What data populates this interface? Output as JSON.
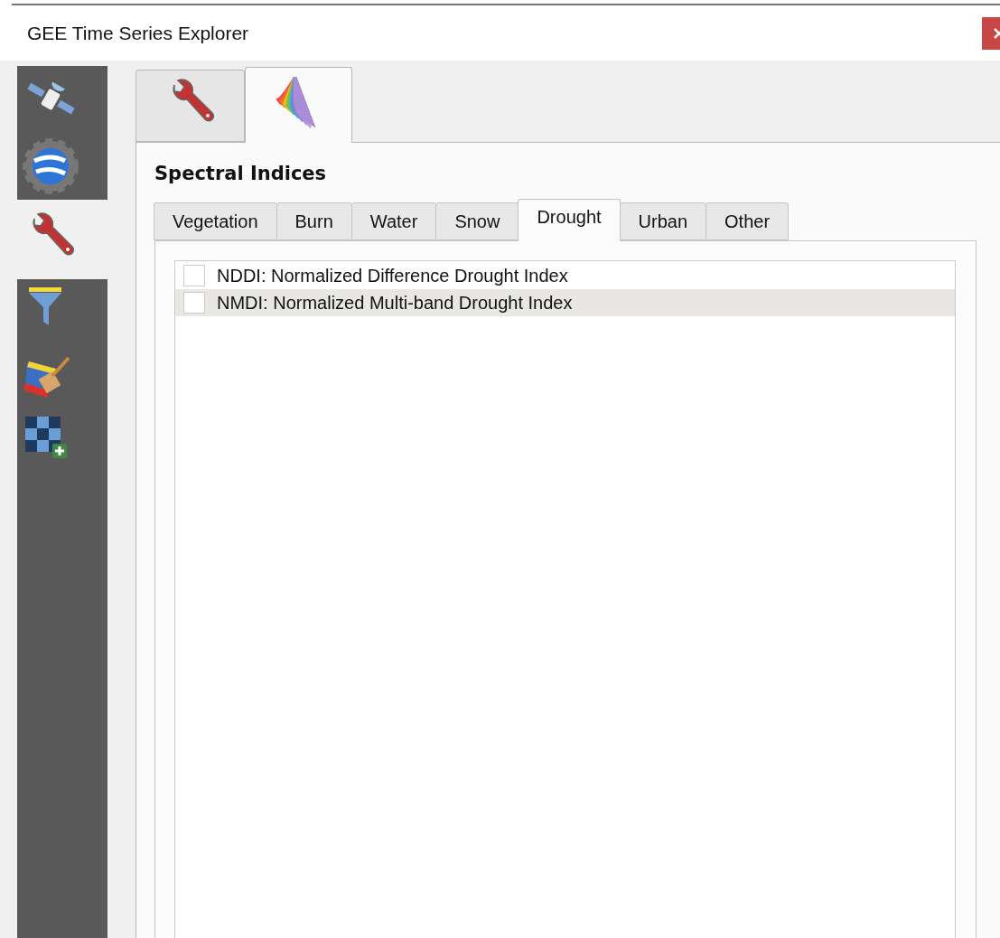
{
  "window": {
    "title": "GEE Time Series Explorer"
  },
  "sidebar": {
    "items": [
      {
        "kind": "satellite",
        "selected": false
      },
      {
        "kind": "globe",
        "selected": false
      },
      {
        "kind": "wrench",
        "selected": true
      },
      {
        "kind": "filter",
        "selected": false
      },
      {
        "kind": "paint",
        "selected": false
      },
      {
        "kind": "grid",
        "selected": false
      }
    ]
  },
  "icon_tabs": [
    {
      "kind": "wrench",
      "selected": false
    },
    {
      "kind": "spectrum",
      "selected": true
    }
  ],
  "section_title": "Spectral Indices",
  "tabs": [
    {
      "label": "Vegetation",
      "selected": false
    },
    {
      "label": "Burn",
      "selected": false
    },
    {
      "label": "Water",
      "selected": false
    },
    {
      "label": "Snow",
      "selected": false
    },
    {
      "label": "Drought",
      "selected": true
    },
    {
      "label": "Urban",
      "selected": false
    },
    {
      "label": "Other",
      "selected": false
    }
  ],
  "indices": [
    {
      "label": "NDDI: Normalized Difference Drought Index",
      "checked": false,
      "selected": false
    },
    {
      "label": "NMDI: Normalized Multi-band Drought Index",
      "checked": false,
      "selected": true
    }
  ]
}
